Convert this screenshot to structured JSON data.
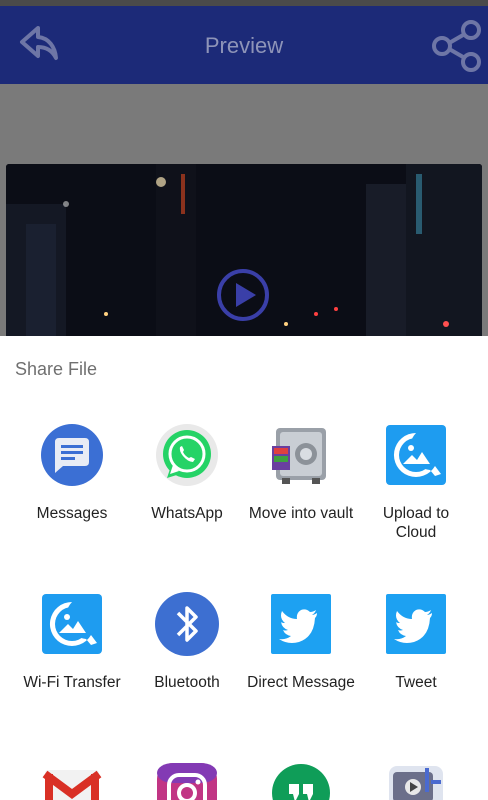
{
  "header": {
    "title": "Preview",
    "back_icon": "back-arrow-icon",
    "share_icon": "share-icon"
  },
  "sheet": {
    "title": "Share File",
    "apps": [
      {
        "label": "Messages",
        "icon": "messages-icon"
      },
      {
        "label": "WhatsApp",
        "icon": "whatsapp-icon"
      },
      {
        "label": "Move into vault",
        "icon": "vault-icon"
      },
      {
        "label": "Upload to\nCloud",
        "icon": "cloud-upload-icon"
      },
      {
        "label": "Wi-Fi Transfer",
        "icon": "wifi-transfer-icon"
      },
      {
        "label": "Bluetooth",
        "icon": "bluetooth-icon"
      },
      {
        "label": "Direct Message",
        "icon": "twitter-dm-icon"
      },
      {
        "label": "Tweet",
        "icon": "twitter-icon"
      },
      {
        "label": "",
        "icon": "gmail-icon"
      },
      {
        "label": "",
        "icon": "instagram-icon"
      },
      {
        "label": "",
        "icon": "hangouts-icon"
      },
      {
        "label": "",
        "icon": "video-editor-icon"
      }
    ]
  },
  "colors": {
    "appbar": "#1c2a78",
    "twitter": "#1da1f2",
    "bluetooth": "#3d6fd1",
    "whatsapp": "#25d366",
    "messages": "#3b6fd4",
    "qfile": "#1e9cf0"
  }
}
